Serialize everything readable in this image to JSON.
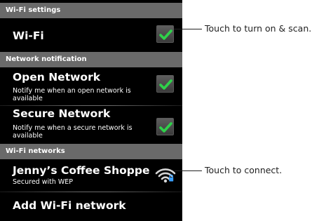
{
  "sections": {
    "wifi_settings": "Wi-Fi settings",
    "network_notification": "Network notification",
    "wifi_networks": "Wi-Fi networks"
  },
  "wifi": {
    "title": "Wi-Fi",
    "checked": true
  },
  "open_network": {
    "title": "Open Network",
    "subtitle": "Notify me when an open network is available",
    "checked": true
  },
  "secure_network": {
    "title": "Secure Network",
    "subtitle": "Notify me when a secure network is available",
    "checked": true
  },
  "network": {
    "name": "Jenny’s Coffee Shoppe",
    "security": "Secured with WEP",
    "icon": "wifi-secured-icon"
  },
  "add_network": {
    "label": "Add Wi-Fi network"
  },
  "callouts": {
    "toggle": "Touch to turn on & scan.",
    "connect": "Touch to connect."
  },
  "colors": {
    "check": "#2fd14a",
    "header_bg": "#6a6a6a",
    "screen_bg": "#000000",
    "lock": "#3aa0ff"
  }
}
